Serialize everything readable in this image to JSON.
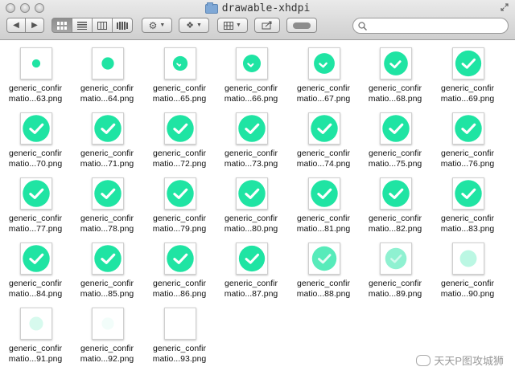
{
  "window": {
    "title": "drawable-xhdpi"
  },
  "toolbar": {
    "search_placeholder": ""
  },
  "accent": "#1fe4a3",
  "files": [
    {
      "name1": "generic_confir",
      "name2": "matio...63.png",
      "size": 0.27,
      "tick": 0.0,
      "opacity": 1.0
    },
    {
      "name1": "generic_confir",
      "name2": "matio...64.png",
      "size": 0.4,
      "tick": 0.0,
      "opacity": 1.0
    },
    {
      "name1": "generic_confir",
      "name2": "matio...65.png",
      "size": 0.48,
      "tick": 0.25,
      "opacity": 1.0
    },
    {
      "name1": "generic_confir",
      "name2": "matio...66.png",
      "size": 0.58,
      "tick": 0.4,
      "opacity": 1.0
    },
    {
      "name1": "generic_confir",
      "name2": "matio...67.png",
      "size": 0.68,
      "tick": 0.55,
      "opacity": 1.0
    },
    {
      "name1": "generic_confir",
      "name2": "matio...68.png",
      "size": 0.78,
      "tick": 0.8,
      "opacity": 1.0
    },
    {
      "name1": "generic_confir",
      "name2": "matio...69.png",
      "size": 0.85,
      "tick": 1.0,
      "opacity": 1.0
    },
    {
      "name1": "generic_confir",
      "name2": "matio...70.png",
      "size": 0.88,
      "tick": 1.0,
      "opacity": 1.0
    },
    {
      "name1": "generic_confir",
      "name2": "matio...71.png",
      "size": 0.88,
      "tick": 1.0,
      "opacity": 1.0
    },
    {
      "name1": "generic_confir",
      "name2": "matio...72.png",
      "size": 0.88,
      "tick": 1.0,
      "opacity": 1.0
    },
    {
      "name1": "generic_confir",
      "name2": "matio...73.png",
      "size": 0.88,
      "tick": 1.0,
      "opacity": 1.0
    },
    {
      "name1": "generic_confir",
      "name2": "matio...74.png",
      "size": 0.88,
      "tick": 1.0,
      "opacity": 1.0
    },
    {
      "name1": "generic_confir",
      "name2": "matio...75.png",
      "size": 0.88,
      "tick": 1.0,
      "opacity": 1.0
    },
    {
      "name1": "generic_confir",
      "name2": "matio...76.png",
      "size": 0.88,
      "tick": 1.0,
      "opacity": 1.0
    },
    {
      "name1": "generic_confir",
      "name2": "matio...77.png",
      "size": 0.88,
      "tick": 1.0,
      "opacity": 1.0
    },
    {
      "name1": "generic_confir",
      "name2": "matio...78.png",
      "size": 0.88,
      "tick": 1.0,
      "opacity": 1.0
    },
    {
      "name1": "generic_confir",
      "name2": "matio...79.png",
      "size": 0.88,
      "tick": 1.0,
      "opacity": 1.0
    },
    {
      "name1": "generic_confir",
      "name2": "matio...80.png",
      "size": 0.88,
      "tick": 1.0,
      "opacity": 1.0
    },
    {
      "name1": "generic_confir",
      "name2": "matio...81.png",
      "size": 0.88,
      "tick": 1.0,
      "opacity": 1.0
    },
    {
      "name1": "generic_confir",
      "name2": "matio...82.png",
      "size": 0.88,
      "tick": 1.0,
      "opacity": 1.0
    },
    {
      "name1": "generic_confir",
      "name2": "matio...83.png",
      "size": 0.88,
      "tick": 1.0,
      "opacity": 1.0
    },
    {
      "name1": "generic_confir",
      "name2": "matio...84.png",
      "size": 0.88,
      "tick": 1.0,
      "opacity": 1.0
    },
    {
      "name1": "generic_confir",
      "name2": "matio...85.png",
      "size": 0.88,
      "tick": 1.0,
      "opacity": 1.0
    },
    {
      "name1": "generic_confir",
      "name2": "matio...86.png",
      "size": 0.88,
      "tick": 1.0,
      "opacity": 1.0
    },
    {
      "name1": "generic_confir",
      "name2": "matio...87.png",
      "size": 0.85,
      "tick": 1.0,
      "opacity": 1.0
    },
    {
      "name1": "generic_confir",
      "name2": "matio...88.png",
      "size": 0.8,
      "tick": 1.0,
      "opacity": 0.75
    },
    {
      "name1": "generic_confir",
      "name2": "matio...89.png",
      "size": 0.7,
      "tick": 1.0,
      "opacity": 0.5
    },
    {
      "name1": "generic_confir",
      "name2": "matio...90.png",
      "size": 0.55,
      "tick": 0.0,
      "opacity": 0.3
    },
    {
      "name1": "generic_confir",
      "name2": "matio...91.png",
      "size": 0.45,
      "tick": 0.0,
      "opacity": 0.18
    },
    {
      "name1": "generic_confir",
      "name2": "matio...92.png",
      "size": 0.4,
      "tick": 0.0,
      "opacity": 0.06
    },
    {
      "name1": "generic_confir",
      "name2": "matio...93.png",
      "size": 0.0,
      "tick": 0.0,
      "opacity": 0.0
    }
  ],
  "watermark": "天天P图攻城狮"
}
